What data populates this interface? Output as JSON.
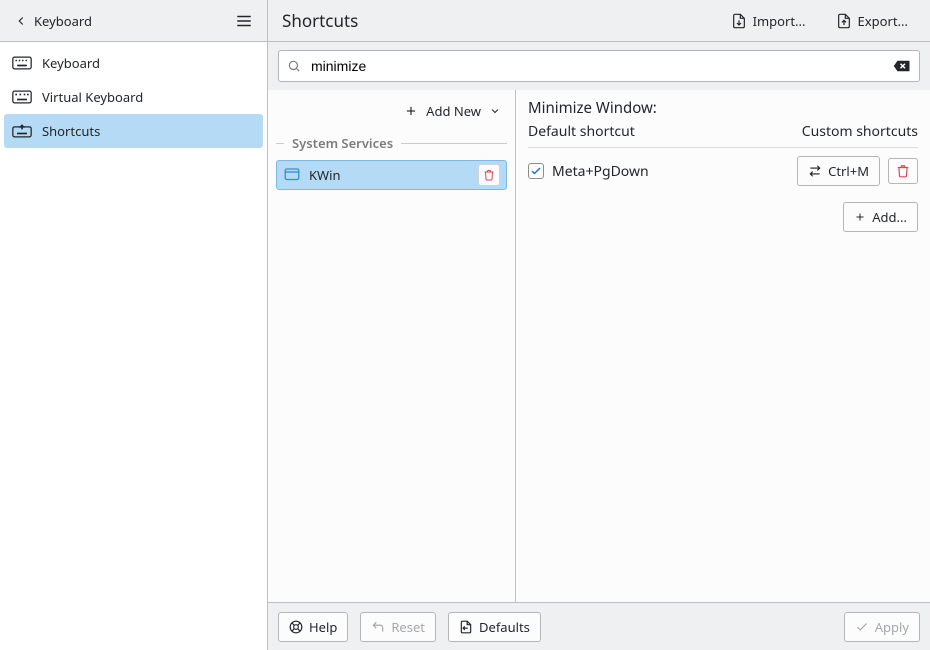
{
  "header": {
    "back_label": "Keyboard",
    "page_title": "Shortcuts",
    "import_label": "Import...",
    "export_label": "Export..."
  },
  "sidebar": {
    "items": [
      {
        "label": "Keyboard"
      },
      {
        "label": "Virtual Keyboard"
      },
      {
        "label": "Shortcuts"
      }
    ]
  },
  "search": {
    "value": "minimize"
  },
  "list": {
    "add_new_label": "Add New",
    "section_label": "System Services",
    "entries": [
      {
        "label": "KWin"
      }
    ]
  },
  "detail": {
    "title": "Minimize Window:",
    "default_hdr": "Default shortcut",
    "custom_hdr": "Custom shortcuts",
    "default_shortcut": "Meta+PgDown",
    "custom_shortcut": "Ctrl+M",
    "add_label": "Add..."
  },
  "footer": {
    "help_label": "Help",
    "reset_label": "Reset",
    "defaults_label": "Defaults",
    "apply_label": "Apply"
  }
}
